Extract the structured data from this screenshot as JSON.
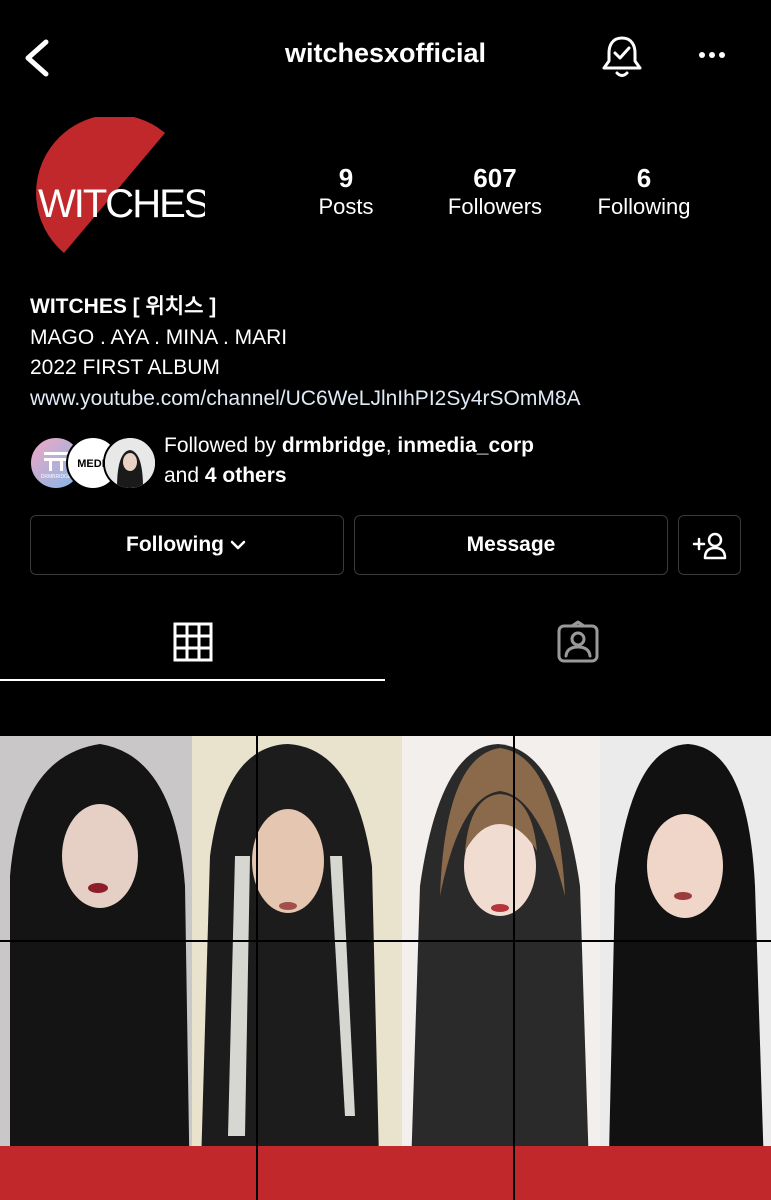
{
  "header": {
    "username": "witchesxofficial",
    "back_icon": "chevron-left-icon",
    "notification_icon": "bell-check-icon",
    "more_icon": "more-horizontal-icon"
  },
  "profile": {
    "avatar_text": "WITCHES",
    "stats": [
      {
        "value": "9",
        "label": "Posts"
      },
      {
        "value": "607",
        "label": "Followers"
      },
      {
        "value": "6",
        "label": "Following"
      }
    ]
  },
  "bio": {
    "name": "WITCHES [ 위치스 ]",
    "line1": "MAGO . AYA . MINA . MARI",
    "line2": "2022 FIRST ALBUM",
    "link": "www.youtube.com/channel/UC6WeLJlnIhPI2Sy4rSOmM8A"
  },
  "followed_by": {
    "prefix": "Followed by ",
    "user1": "drmbridge",
    "sep": ", ",
    "user2": "inmedia_corp",
    "and": "and ",
    "others": "4 others",
    "avatar2_text": "MEDIA",
    "avatar1_text": "DRMBRIDGE"
  },
  "actions": {
    "following_label": "Following",
    "message_label": "Message"
  },
  "tabs": [
    "grid-icon",
    "tagged-icon"
  ],
  "colors": {
    "brand_red": "#c0282b",
    "background": "#000000",
    "link": "#e0eaf6"
  }
}
